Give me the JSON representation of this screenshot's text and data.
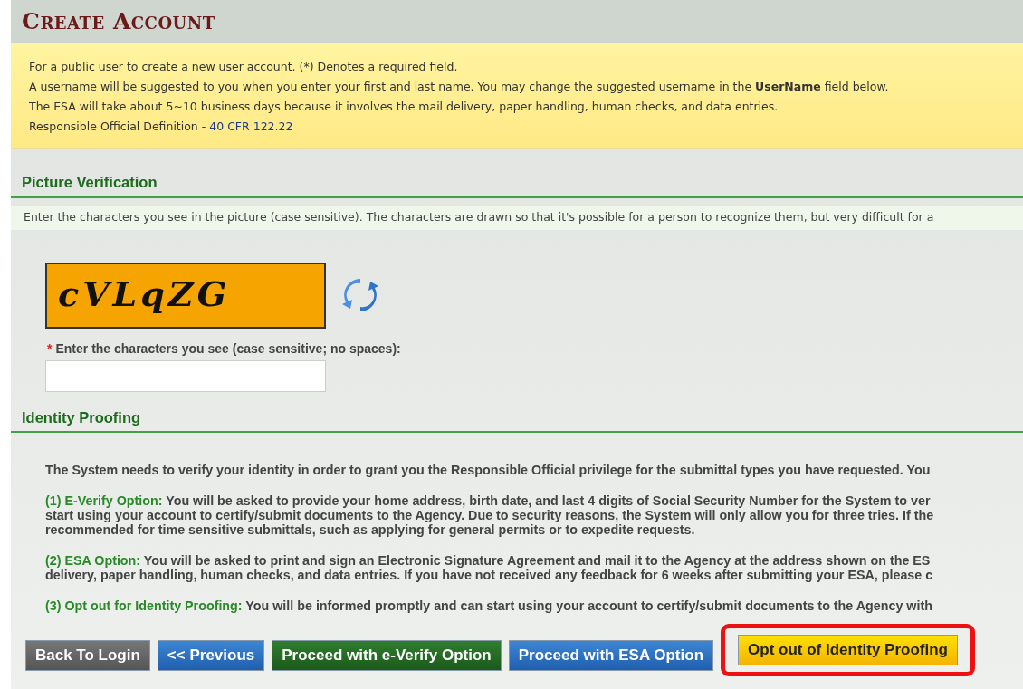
{
  "page_title": "Create Account",
  "notice": {
    "lines": [
      "For a public user to create a new user account. (*) Denotes a required field.",
      "A username will be suggested to you when you enter your first and last name. You may change the suggested username in the **UserName** field below.",
      "The ESA will take about 5~10 business days because it involves the mail delivery, paper handling, human checks, and data entries."
    ],
    "definition_label": "Responsible Official Definition - ",
    "definition_link": "40 CFR 122.22"
  },
  "picture_verification": {
    "heading": "Picture Verification",
    "instruction": "Enter the characters you see in the picture (case sensitive). The characters are drawn so that it's possible for a person to recognize them, but very difficult for a",
    "captcha_text": "cVLqZG",
    "required_mark": "*",
    "field_label": "Enter the characters you see (case sensitive; no spaces):"
  },
  "identity_proofing": {
    "heading": "Identity Proofing",
    "paragraphs": [
      {
        "lines": [
          "The System needs to verify your identity in order to grant you the Responsible Official privilege for the submittal types you have requested. You"
        ]
      },
      {
        "label": "(1) E-Verify Option:",
        "lines": [
          " You will be asked to provide your home address, birth date, and last 4 digits of Social Security Number for the System to ver",
          "start using your account to certify/submit documents to the Agency. Due to security reasons, the System will only allow you for three tries. If the",
          "recommended for time sensitive submittals, such as applying for general permits or to expedite requests."
        ]
      },
      {
        "label": "(2) ESA Option:",
        "lines": [
          " You will be asked to print and sign an Electronic Signature Agreement and mail it to the Agency at the address shown on the ES",
          "delivery, paper handling, human checks, and data entries. If you have not received any feedback for 6 weeks after submitting your ESA, please c"
        ]
      },
      {
        "label": "(3) Opt out for Identity Proofing:",
        "lines": [
          " You will be informed promptly and can start using your account to certify/submit documents to the Agency with"
        ]
      }
    ]
  },
  "buttons": [
    {
      "label": "Back To Login",
      "kind": "gray",
      "highlighted": false
    },
    {
      "label": "<< Previous",
      "kind": "blue",
      "highlighted": false
    },
    {
      "label": "Proceed with e-Verify Option",
      "kind": "green",
      "highlighted": false
    },
    {
      "label": "Proceed with ESA Option",
      "kind": "blue",
      "highlighted": false
    },
    {
      "label": "Opt out of Identity Proofing",
      "kind": "yellow",
      "highlighted": true
    }
  ]
}
